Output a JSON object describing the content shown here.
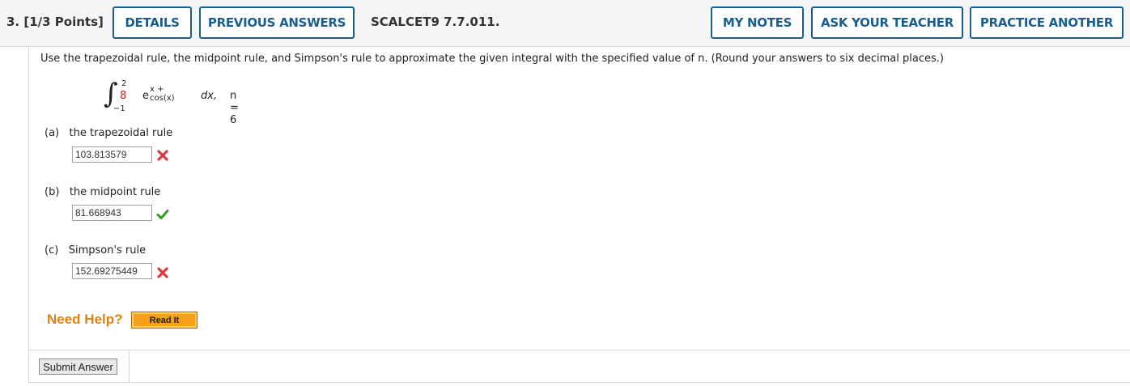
{
  "header": {
    "question_number": "3.",
    "points": "[1/3 Points]",
    "details_label": "DETAILS",
    "previous_answers_label": "PREVIOUS ANSWERS",
    "problem_code": "SCALCET9 7.7.011.",
    "my_notes_label": "MY NOTES",
    "ask_teacher_label": "ASK YOUR TEACHER",
    "practice_another_label": "PRACTICE ANOTHER"
  },
  "question": {
    "instructions": "Use the trapezoidal rule, the midpoint rule, and Simpson's rule to approximate the given integral with the specified value of n. (Round your answers to six decimal places.)",
    "integral": {
      "upper_limit": "2",
      "lower_limit": "−1",
      "coefficient": "8",
      "base": "e",
      "exponent": "x + cos(x)",
      "differential": "dx,",
      "n_value": "n = 6"
    }
  },
  "parts": [
    {
      "letter": "(a)",
      "label": "the trapezoidal rule",
      "answer": "103.813579",
      "status": "incorrect"
    },
    {
      "letter": "(b)",
      "label": "the midpoint rule",
      "answer": "81.668943",
      "status": "correct"
    },
    {
      "letter": "(c)",
      "label": "Simpson's rule",
      "answer": "152.69275449",
      "status": "incorrect"
    }
  ],
  "help": {
    "need_help_label": "Need Help?",
    "read_it_label": "Read It"
  },
  "submit_label": "Submit Answer",
  "colors": {
    "button_blue": "#1a5e8e",
    "correct_green": "#3a9a2a",
    "incorrect_red": "#e0393e",
    "help_orange": "#e0820f"
  }
}
